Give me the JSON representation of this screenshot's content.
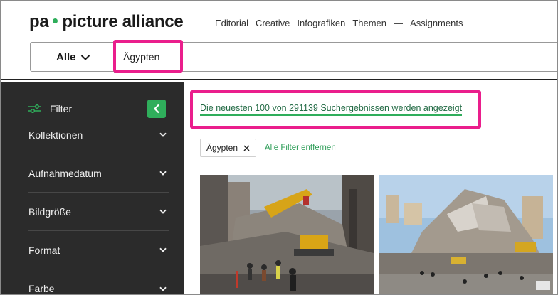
{
  "logo": {
    "left": "pa",
    "right": "picture alliance"
  },
  "nav": [
    "Editorial",
    "Creative",
    "Infografiken",
    "Themen",
    "—",
    "Assignments"
  ],
  "search": {
    "scope_label": "Alle",
    "query": "Ägypten"
  },
  "sidebar": {
    "filter_label": "Filter",
    "facets": [
      "Kollektionen",
      "Aufnahmedatum",
      "Bildgröße",
      "Format",
      "Farbe"
    ]
  },
  "results": {
    "summary": "Die neuesten 100 von 291139 Suchergebnissen werden angezeigt",
    "active_filter": "Ägypten",
    "clear_filters": "Alle Filter entfernen"
  },
  "colors": {
    "accent_green": "#2fae5b",
    "highlight_pink": "#ea1e8c",
    "sidebar_bg": "#2b2b2b"
  },
  "icons": [
    "chevron-down-icon",
    "filter-sliders-icon",
    "chevron-left-icon",
    "close-icon"
  ]
}
